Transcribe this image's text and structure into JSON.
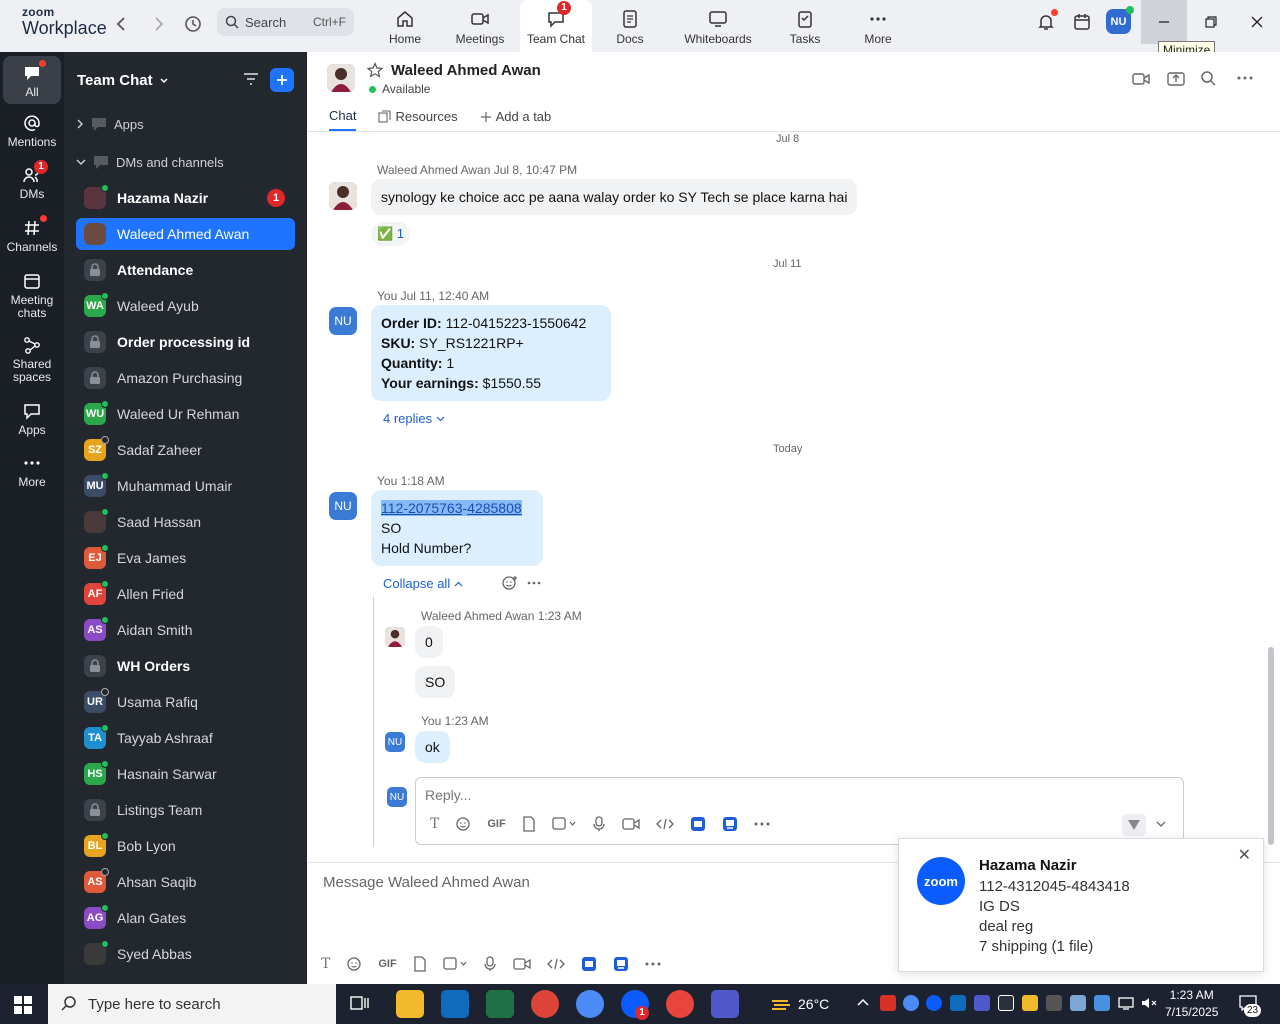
{
  "topbar": {
    "logo_top": "zoom",
    "logo_bottom": "Workplace",
    "search_placeholder": "Search",
    "search_shortcut": "Ctrl+F",
    "tabs": [
      {
        "label": "Home",
        "icon": "home-icon"
      },
      {
        "label": "Meetings",
        "icon": "video-icon"
      },
      {
        "label": "Team Chat",
        "icon": "chat-icon",
        "badge": "1",
        "active": true
      },
      {
        "label": "Docs",
        "icon": "doc-icon"
      },
      {
        "label": "Whiteboards",
        "icon": "whiteboard-icon"
      },
      {
        "label": "Tasks",
        "icon": "tasks-icon"
      },
      {
        "label": "More",
        "icon": "more-icon"
      }
    ],
    "avatar_initials": "NU",
    "tooltip": "Minimize"
  },
  "rail": {
    "items": [
      {
        "label": "All",
        "icon": "chat-icon",
        "active": true
      },
      {
        "label": "Mentions",
        "icon": "at-icon"
      },
      {
        "label": "DMs",
        "icon": "people-icon",
        "badge": "1"
      },
      {
        "label": "Channels",
        "icon": "hash-icon"
      },
      {
        "label": "Meeting chats",
        "icon": "calendar-icon"
      },
      {
        "label": "Shared spaces",
        "icon": "share-icon"
      },
      {
        "label": "Apps",
        "icon": "apps-icon"
      },
      {
        "label": "More",
        "icon": "more-icon"
      }
    ]
  },
  "sidebar": {
    "title": "Team Chat",
    "apps_label": "Apps",
    "dms_label": "DMs and channels",
    "items": [
      {
        "label": "Hazama Nazir",
        "av": "",
        "color": "#5a3540",
        "status": "on",
        "bold": true,
        "badge": "1"
      },
      {
        "label": "Waleed Ahmed Awan",
        "av": "",
        "color": "#6b4a3f",
        "status": "",
        "selected": true
      },
      {
        "label": "Attendance",
        "lock": true,
        "bold": true
      },
      {
        "label": "Waleed Ayub",
        "av": "WA",
        "color": "#2aa84a",
        "status": "on"
      },
      {
        "label": "Order processing id",
        "lock": true,
        "bold": true
      },
      {
        "label": "Amazon Purchasing",
        "lock": true
      },
      {
        "label": "Waleed Ur Rehman",
        "av": "WU",
        "color": "#2aa84a",
        "status": "on"
      },
      {
        "label": "Sadaf Zaheer",
        "av": "SZ",
        "color": "#e8a41c",
        "status": "off"
      },
      {
        "label": "Muhammad Umair",
        "av": "MU",
        "color": "#3b4d66",
        "status": "on"
      },
      {
        "label": "Saad Hassan",
        "av": "",
        "color": "#4a3a3a",
        "status": "on"
      },
      {
        "label": "Eva James",
        "av": "EJ",
        "color": "#e05a3a",
        "status": "on"
      },
      {
        "label": "Allen Fried",
        "av": "AF",
        "color": "#e0443a",
        "status": "on"
      },
      {
        "label": "Aidan Smith",
        "av": "AS",
        "color": "#8a4cc4",
        "status": "on"
      },
      {
        "label": "WH Orders",
        "lock": true,
        "bold": true
      },
      {
        "label": "Usama Rafiq",
        "av": "UR",
        "color": "#3b4d66",
        "status": "off"
      },
      {
        "label": "Tayyab Ashraaf",
        "av": "TA",
        "color": "#1f8fd0",
        "status": "on"
      },
      {
        "label": "Hasnain Sarwar",
        "av": "HS",
        "color": "#2aa84a",
        "status": "on"
      },
      {
        "label": "Listings Team",
        "lock": true
      },
      {
        "label": "Bob Lyon",
        "av": "BL",
        "color": "#e8a41c",
        "status": "on"
      },
      {
        "label": "Ahsan Saqib",
        "av": "AS",
        "color": "#e05a3a",
        "status": "off"
      },
      {
        "label": "Alan Gates",
        "av": "AG",
        "color": "#8a4cc4",
        "status": "on"
      },
      {
        "label": "Syed Abbas",
        "av": "",
        "color": "#3a3a3a",
        "status": "on"
      }
    ]
  },
  "header": {
    "name": "Waleed Ahmed Awan",
    "status": "Available",
    "tabs": [
      "Chat",
      "Resources",
      "Add a tab"
    ]
  },
  "messages": {
    "date1": "Jul 8",
    "m1_meta": "Waleed Ahmed Awan Jul 8, 10:47 PM",
    "m1_text": "synology ke choice acc pe aana walay order ko SY Tech se place karna hai",
    "m1_reaction": "✅ 1",
    "date2": "Jul 11",
    "m2_meta": "You Jul 11, 12:40 AM",
    "m2_lines": [
      {
        "k": "Order ID:",
        "v": " 112-0415223-1550642"
      },
      {
        "k": "SKU:",
        "v": " SY_RS1221RP+"
      },
      {
        "k": "Quantity:",
        "v": " 1"
      },
      {
        "k": "Your earnings:",
        "v": " $1550.55"
      }
    ],
    "m2_replies": "4 replies",
    "date3": "Today",
    "m3_meta": "You 1:18 AM",
    "m3_link_a": "112-2075763",
    "m3_link_sep": "-",
    "m3_link_b": "4285808",
    "m3_l2": "SO",
    "m3_l3": "Hold Number?",
    "collapse": "Collapse all",
    "r1_meta": "Waleed Ahmed Awan 1:23 AM",
    "r1_a": "0",
    "r1_b": "SO",
    "r2_meta": "You 1:23 AM",
    "r2_text": "ok",
    "reply_placeholder": "Reply...",
    "composer_placeholder": "Message Waleed Ahmed Awan",
    "nu": "NU",
    "gif": "GIF"
  },
  "notification": {
    "logo": "zoom",
    "title": "Hazama Nazir",
    "lines": [
      "112-4312045-4843418",
      "IG DS",
      "deal reg",
      "7 shipping (1 file)"
    ]
  },
  "taskbar": {
    "search_placeholder": "Type here to search",
    "weather": "26°C",
    "time": "1:23 AM",
    "date": "7/15/2025",
    "notif_count": "23",
    "zoom_badge": "1"
  }
}
